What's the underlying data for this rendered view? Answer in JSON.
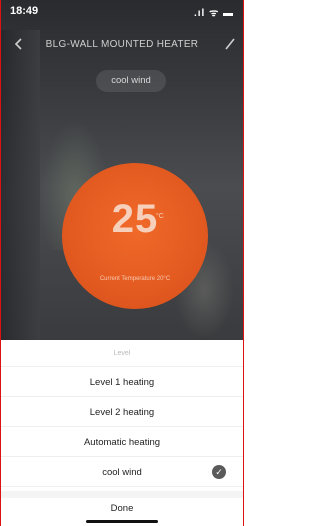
{
  "status_bar": {
    "time": "18:49",
    "signal_text": ".ıl ᯤ ▬"
  },
  "header": {
    "title": "BLG-WALL MOUNTED HEATER",
    "back_icon": "chevron-left-icon",
    "edit_icon": "edit-icon"
  },
  "mode": {
    "label": "cool wind"
  },
  "thermostat": {
    "temperature": "25",
    "unit": "°C",
    "current_label": "Current Temperature 20°C"
  },
  "sheet": {
    "title": "Level",
    "options": [
      {
        "label": "Level 1 heating",
        "selected": false
      },
      {
        "label": "Level 2 heating",
        "selected": false
      },
      {
        "label": "Automatic heating",
        "selected": false
      },
      {
        "label": "cool wind",
        "selected": true
      }
    ],
    "done_label": "Done"
  },
  "colors": {
    "accent": "#e35a20",
    "check": "#5a5a5a"
  }
}
